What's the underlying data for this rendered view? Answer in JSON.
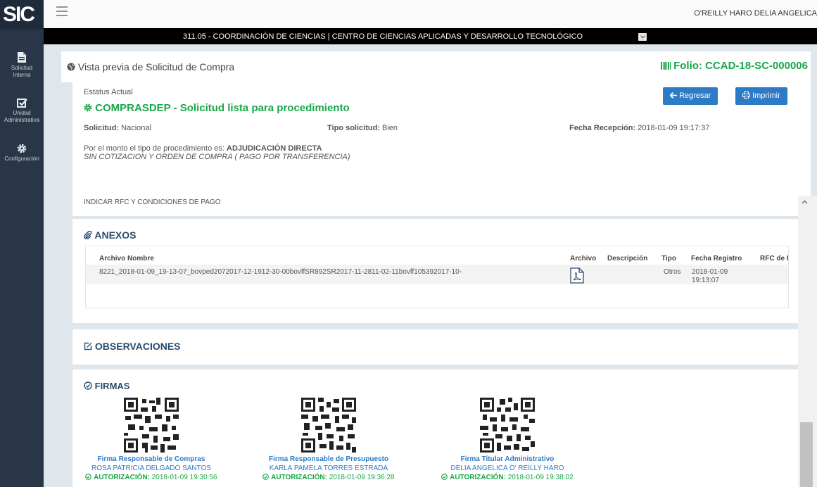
{
  "sidebar": {
    "logo": "SIC",
    "items": [
      {
        "icon": "document-icon",
        "line1": "Solicitud",
        "line2": "Interna"
      },
      {
        "icon": "checkbox-icon",
        "line1": "Unidad",
        "line2": "Administrativa"
      },
      {
        "icon": "gear-icon",
        "line1": "Configuración",
        "line2": ""
      }
    ]
  },
  "topbar": {
    "user": "O'REILLY HARO DELIA ANGELICA"
  },
  "orgbar": {
    "text": "311.05 - COORDINACIÓN DE CIENCIAS | CENTRO DE CIENCIAS APLICADAS Y DESARROLLO TECNOLÓGICO"
  },
  "header": {
    "title": "Vista previa de Solicitud de Compra",
    "folio": "Folio: CCAD-18-SC-000006"
  },
  "status": {
    "label": "Estatus Actual",
    "title": "COMPRASDEP - Solicitud lista para procedimiento",
    "back_button": "Regresar",
    "print_button": "Imprimir"
  },
  "details": {
    "solicitud_label": "Solicitud:",
    "solicitud_value": "Nacional",
    "tipo_label": "Tipo solicitud:",
    "tipo_value": "Bien",
    "fecha_label": "Fecha Recepción:",
    "fecha_value": "2018-01-09 19:17:37",
    "monto_prefix": "Por el monto el tipo de procedimiento es:",
    "monto_type": "ADJUDICACIÓN DIRECTA",
    "monto_detail": "SIN COTIZACION Y ORDEN DE COMPRA ( PAGO POR TRANSFERENCIA)"
  },
  "strip": {
    "text": "INDICAR RFC Y CONDICIONES DE PAGO"
  },
  "anexos": {
    "title": "ANEXOS",
    "headers": [
      "Archivo Nombre",
      "Archivo",
      "Descripción",
      "Tipo",
      "Fecha Registro",
      "RFC de Pr"
    ],
    "rows": [
      {
        "nombre": "8221_2018-01-09_19-13-07_bovped2072017-12-1912-30-00bovffSR892SR2017-11-2811-02-11bovff105392017-10-",
        "tipo": "Otros",
        "fecha1": "2018-01-09",
        "fecha2": "19:13:07"
      }
    ]
  },
  "observaciones": {
    "title": "OBSERVACIONES"
  },
  "firmas": {
    "title": "FIRMAS",
    "auth_label": "AUTORIZACIÓN:",
    "items": [
      {
        "role": "Firma Responsable de Compras",
        "name": "ROSA PATRICIA DELGADO SANTOS",
        "date": "2018-01-09 19:30:56"
      },
      {
        "role": "Firma Responsable de Presupuesto",
        "name": "KARLA PAMELA TORRES ESTRADA",
        "date": "2018-01-09 19:36:28"
      },
      {
        "role": "Firma Titular Administrativo",
        "name": "DELIA ANGELICA O' REILLY HARO",
        "date": "2018-01-09 19:38:02"
      }
    ]
  },
  "colors": {
    "sidebar": "#283647",
    "accent": "#2d7ac6",
    "success": "#1aa64a",
    "section": "#2b4c6e"
  }
}
